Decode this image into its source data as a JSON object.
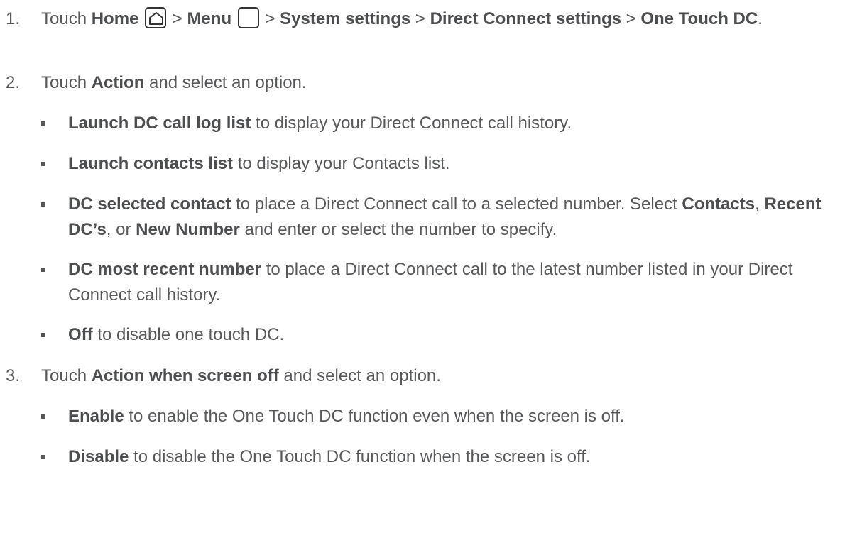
{
  "steps": [
    {
      "number": "1.",
      "parts": [
        {
          "t": "Touch "
        },
        {
          "b": "Home"
        },
        {
          "t": " "
        },
        {
          "icon": "home-icon"
        },
        {
          "t": " > "
        },
        {
          "b": "Menu"
        },
        {
          "t": " "
        },
        {
          "icon": "menu-icon"
        },
        {
          "t": " > "
        },
        {
          "b": "System settings"
        },
        {
          "t": " > "
        },
        {
          "b": "Direct Connect settings"
        },
        {
          "t": " > "
        },
        {
          "b": "One Touch DC"
        },
        {
          "t": "."
        }
      ]
    },
    {
      "number": "2.",
      "parts": [
        {
          "t": "Touch "
        },
        {
          "b": "Action"
        },
        {
          "t": " and select an option."
        }
      ],
      "bullets": [
        [
          {
            "b": "Launch DC call log list"
          },
          {
            "t": " to display your Direct Connect call history."
          }
        ],
        [
          {
            "b": "Launch contacts list"
          },
          {
            "t": " to display your Contacts list."
          }
        ],
        [
          {
            "b": "DC selected contact"
          },
          {
            "t": " to place a Direct Connect call to a selected number. Select "
          },
          {
            "b": "Contacts"
          },
          {
            "t": ", "
          },
          {
            "b": "Recent DC’s"
          },
          {
            "t": ", or "
          },
          {
            "b": "New Number"
          },
          {
            "t": " and enter or select the number to specify."
          }
        ],
        [
          {
            "b": "DC most recent number"
          },
          {
            "t": " to place a Direct Connect call to the latest number listed in your Direct Connect call history."
          }
        ],
        [
          {
            "b": "Off"
          },
          {
            "t": " to disable one touch DC."
          }
        ]
      ]
    },
    {
      "number": "3.",
      "parts": [
        {
          "t": "Touch "
        },
        {
          "b": "Action when screen off"
        },
        {
          "t": " and select an option."
        }
      ],
      "bullets": [
        [
          {
            "b": "Enable"
          },
          {
            "t": " to enable the One Touch DC function even when the screen is off."
          }
        ],
        [
          {
            "b": "Disable"
          },
          {
            "t": " to disable the One Touch DC function when the screen is off."
          }
        ]
      ]
    }
  ]
}
